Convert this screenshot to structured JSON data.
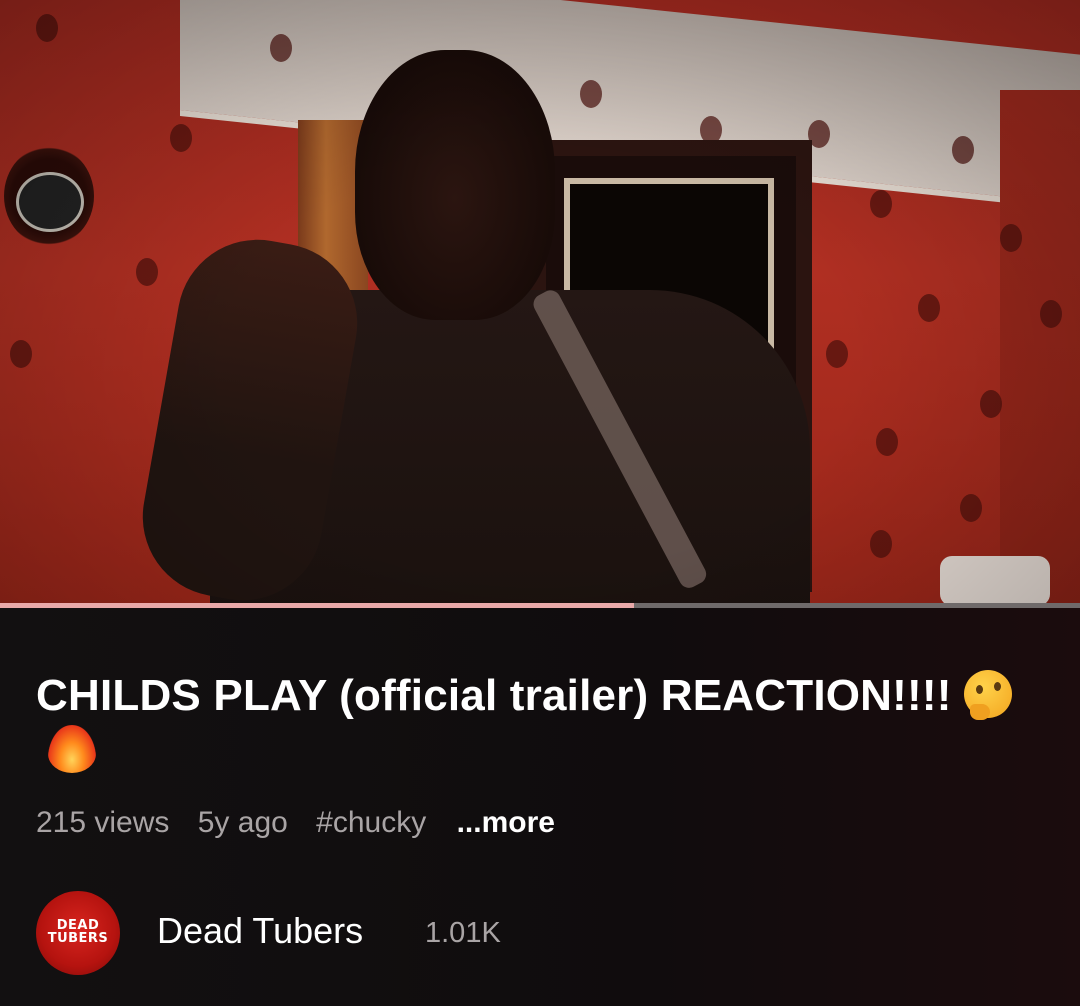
{
  "video": {
    "progress_fraction": 0.587
  },
  "title": {
    "text": "CHILDS PLAY (official trailer) REACTION!!!!",
    "emojis": [
      "thinking-face-icon",
      "fire-icon"
    ]
  },
  "meta": {
    "views": "215 views",
    "age": "5y ago",
    "hashtag": "#chucky",
    "more_label": "...more"
  },
  "channel": {
    "name": "Dead Tubers",
    "subscribers": "1.01K",
    "avatar_logo_line1": "DEAD",
    "avatar_logo_line2": "TUBERS",
    "avatar_color": "#d8251f"
  },
  "colors": {
    "background": "#0c0a0b",
    "secondary_text": "#a9a4a5",
    "progress_played": "#e9a9a9",
    "progress_track": "#6f6a6a"
  }
}
